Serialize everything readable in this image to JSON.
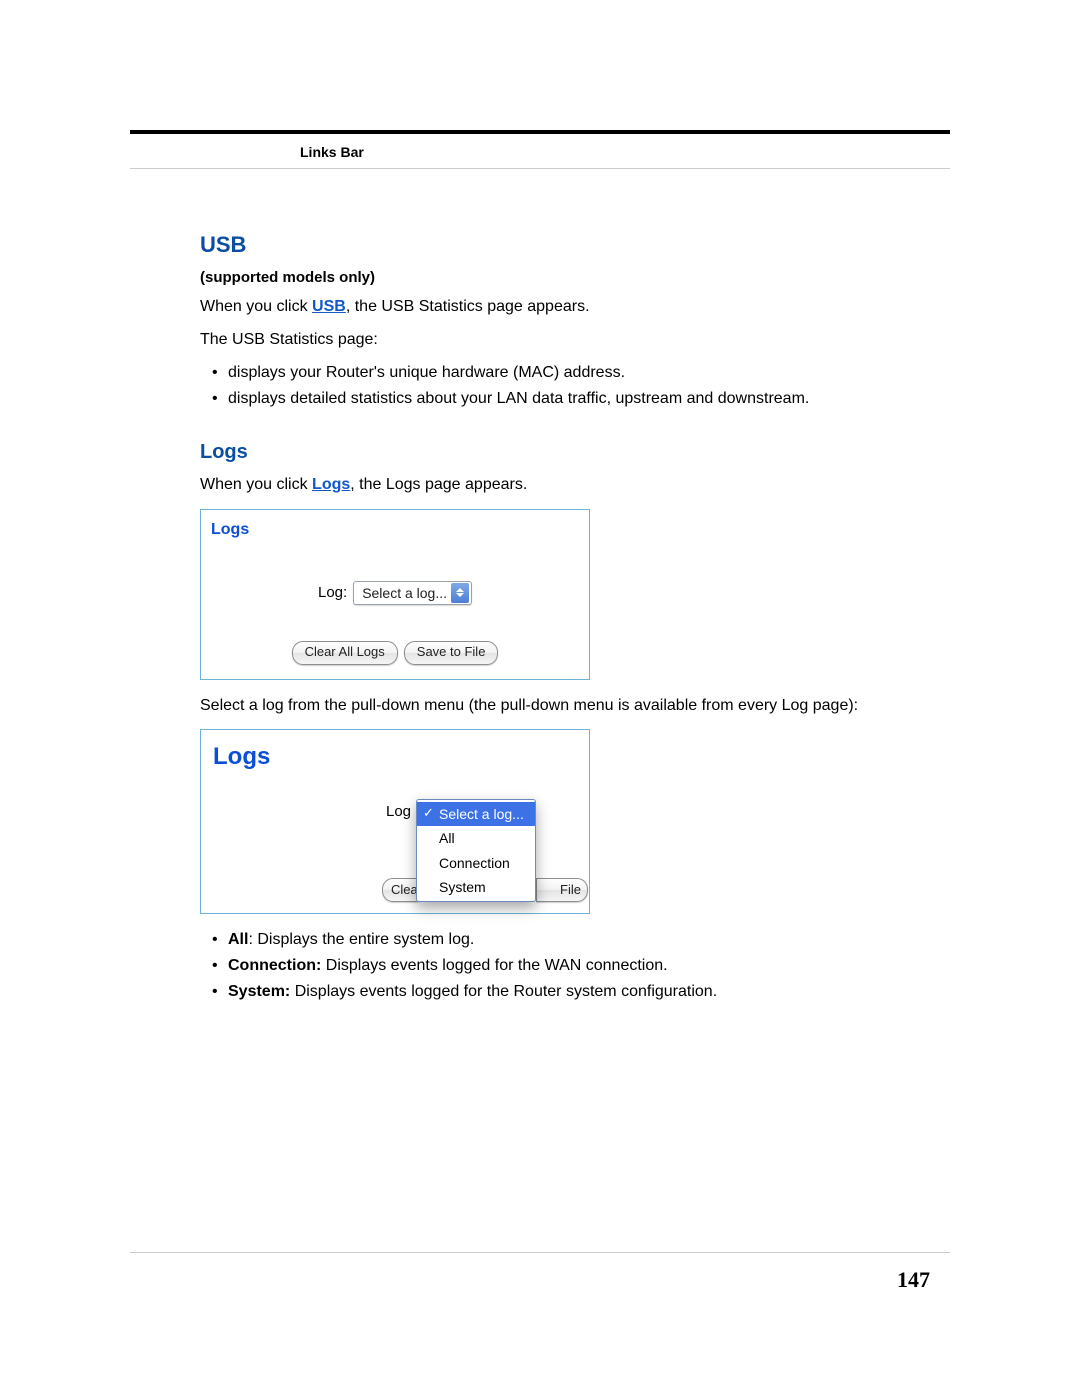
{
  "header": {
    "section": "Links Bar"
  },
  "usb": {
    "heading": "USB",
    "sub": "(supported models only)",
    "intro": {
      "pre": "When you click ",
      "link": "USB",
      "post": ", the USB Statistics page appears."
    },
    "line2": "The USB Statistics page:",
    "bullets": [
      "displays your Router's unique hardware (MAC) address.",
      "displays detailed statistics about your LAN data traffic, upstream and downstream."
    ]
  },
  "logs": {
    "heading": "Logs",
    "intro": {
      "pre": "When you click ",
      "link": "Logs",
      "post": ", the Logs page appears."
    },
    "panel_title": "Logs",
    "select_label": "Log:",
    "select_label_partial": "Log",
    "select_value": "Select a log...",
    "buttons": {
      "clear": "Clear All Logs",
      "save": "Save to File",
      "clear_partial": "Clea",
      "save_partial": "File"
    },
    "select_desc": "Select a log from the pull-down menu (the pull-down menu is available from every Log page):",
    "options": [
      "Select a log...",
      "All",
      "Connection",
      "System"
    ],
    "type_bullets": [
      {
        "label": "All",
        "text": ": Displays the entire system log."
      },
      {
        "label": "Connection:",
        "text": " Displays events logged for the WAN connection."
      },
      {
        "label": "System:",
        "text": " Displays events logged for the Router system configuration."
      }
    ]
  },
  "footer": {
    "page": "147"
  }
}
